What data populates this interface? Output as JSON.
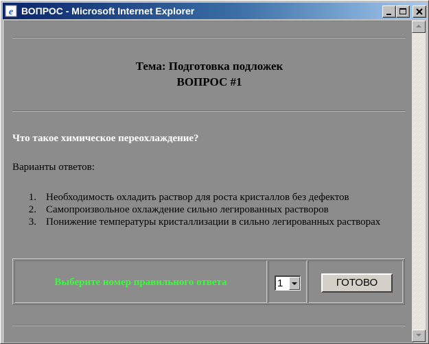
{
  "window": {
    "title": "ВОПРОС - Microsoft Internet Explorer",
    "title_bar_color": "#0a246a"
  },
  "page": {
    "background_color": "#8c8c8c",
    "topic": "Тема: Подготовка подложек",
    "question_number": "ВОПРОС #1",
    "question": "Что такое химическое переохлаждение?",
    "variants_label": "Варианты ответов:",
    "answers": [
      {
        "num": "1.",
        "text": "Необходимость охладить раствор для роста кристаллов без дефектов"
      },
      {
        "num": "2.",
        "text": "Самопроизвольное охлаждение сильно легированных растворов"
      },
      {
        "num": "3.",
        "text": "Понижение температуры кристаллизации в сильно легированных растворах"
      }
    ]
  },
  "answer_form": {
    "prompt": "Выберите номер правильного ответа",
    "prompt_color": "#33ff33",
    "selected_value": "1",
    "submit_label": "ГОТОВО"
  }
}
